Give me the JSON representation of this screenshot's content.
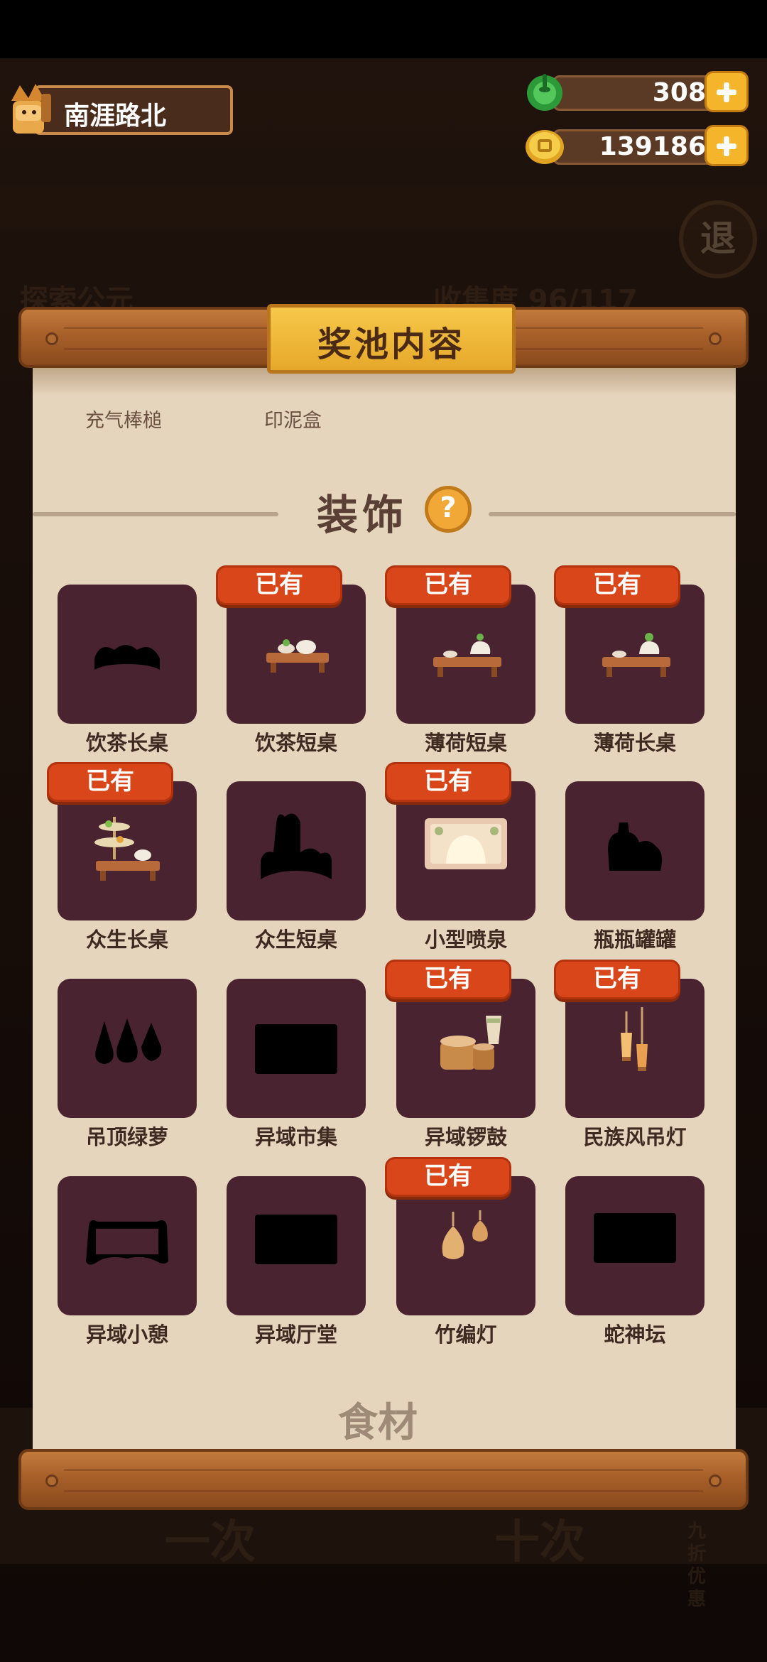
{
  "player": {
    "name": "南涯路北"
  },
  "resources": {
    "gems": "308",
    "coins": "139186"
  },
  "background": {
    "exit_label": "退",
    "left_tag": "探索公元",
    "collection": "收集度 96/117",
    "btn_once": "一次",
    "btn_ten": "十次",
    "discount": "九折优惠"
  },
  "dialog": {
    "title": "奖池内容",
    "prev_items": [
      "充气棒槌",
      "印泥盒"
    ],
    "section_title": "装饰",
    "help_label": "?",
    "owned_label": "已有",
    "next_section_partial": "食材",
    "items": [
      {
        "name": "饮茶长桌",
        "owned": false,
        "icon": "tea-long-table-silhouette-icon"
      },
      {
        "name": "饮茶短桌",
        "owned": true,
        "icon": "tea-short-table-icon"
      },
      {
        "name": "薄荷短桌",
        "owned": true,
        "icon": "mint-short-table-icon"
      },
      {
        "name": "薄荷长桌",
        "owned": true,
        "icon": "mint-long-table-icon"
      },
      {
        "name": "众生长桌",
        "owned": true,
        "icon": "tiered-long-table-icon"
      },
      {
        "name": "众生短桌",
        "owned": false,
        "icon": "tiered-short-table-silhouette-icon"
      },
      {
        "name": "小型喷泉",
        "owned": true,
        "icon": "small-fountain-icon"
      },
      {
        "name": "瓶瓶罐罐",
        "owned": false,
        "icon": "jars-silhouette-icon"
      },
      {
        "name": "吊顶绿萝",
        "owned": false,
        "icon": "hanging-plant-silhouette-icon"
      },
      {
        "name": "异域市集",
        "owned": false,
        "icon": "exotic-market-silhouette-icon"
      },
      {
        "name": "异域锣鼓",
        "owned": true,
        "icon": "exotic-drums-icon"
      },
      {
        "name": "民族风吊灯",
        "owned": true,
        "icon": "ethnic-pendant-lamp-icon"
      },
      {
        "name": "异域小憩",
        "owned": false,
        "icon": "exotic-rest-silhouette-icon"
      },
      {
        "name": "异域厅堂",
        "owned": false,
        "icon": "exotic-hall-silhouette-icon"
      },
      {
        "name": "竹编灯",
        "owned": true,
        "icon": "bamboo-lamp-icon"
      },
      {
        "name": "蛇神坛",
        "owned": false,
        "icon": "snake-altar-silhouette-icon"
      }
    ]
  },
  "colors": {
    "owned_badge": "#d9461a",
    "card_bg": "#4a2330",
    "paper": "#e6d5bd",
    "title_plate": "#f1b53a"
  }
}
